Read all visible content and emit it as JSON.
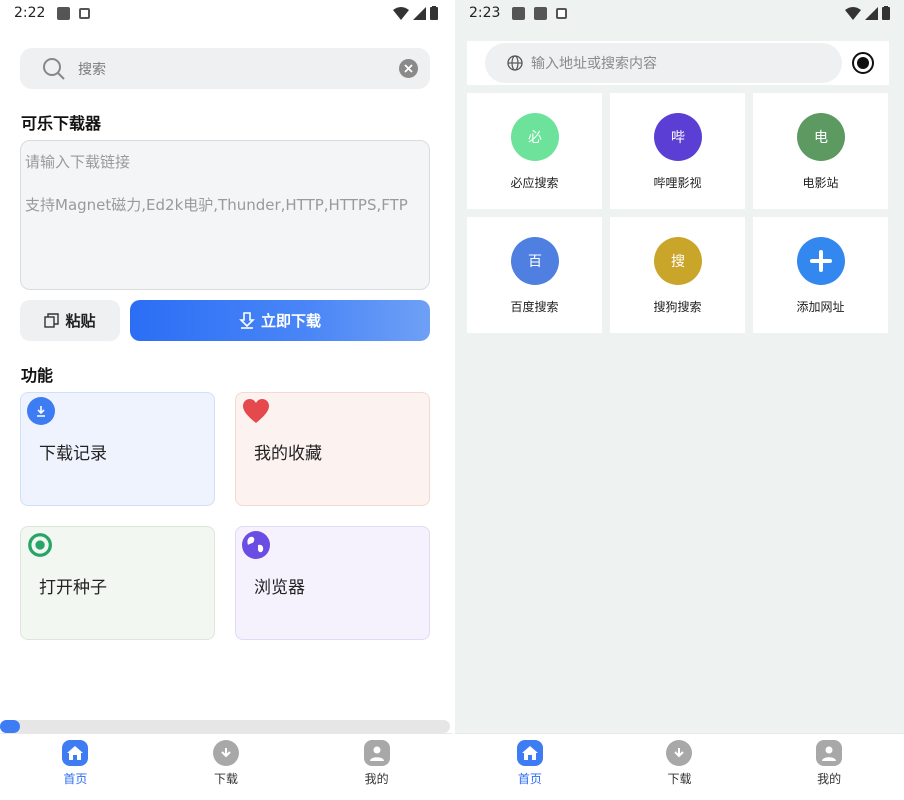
{
  "left": {
    "status": {
      "time": "2:22"
    },
    "search": {
      "label": "搜索"
    },
    "downloader": {
      "title": "可乐下载器",
      "placeholder_line1": "请输入下载链接",
      "placeholder_line2": "支持Magnet磁力,Ed2k电驴,Thunder,HTTP,HTTPS,FTP",
      "paste_label": "粘贴",
      "download_label": "立即下载"
    },
    "features": {
      "title": "功能",
      "items": [
        {
          "label": "下载记录",
          "icon": "download-icon"
        },
        {
          "label": "我的收藏",
          "icon": "heart-icon"
        },
        {
          "label": "打开种子",
          "icon": "eye-icon"
        },
        {
          "label": "浏览器",
          "icon": "globe-icon"
        }
      ]
    },
    "progress": {
      "fraction": 0.045
    }
  },
  "right": {
    "status": {
      "time": "2:23"
    },
    "address": {
      "placeholder": "输入地址或搜索内容"
    },
    "sites": [
      {
        "label": "必应搜索",
        "glyph": "必",
        "color": "#6de29a"
      },
      {
        "label": "哔哩影视",
        "glyph": "哔",
        "color": "#5b3fd4"
      },
      {
        "label": "电影站",
        "glyph": "电",
        "color": "#5d9a62"
      },
      {
        "label": "百度搜索",
        "glyph": "百",
        "color": "#4f7fe0"
      },
      {
        "label": "搜狗搜索",
        "glyph": "搜",
        "color": "#c9a52a"
      },
      {
        "label": "添加网址",
        "glyph": "+",
        "color": "#3388f0"
      }
    ]
  },
  "nav": {
    "items": [
      {
        "label": "首页",
        "icon": "home-icon"
      },
      {
        "label": "下载",
        "icon": "download-nav-icon"
      },
      {
        "label": "我的",
        "icon": "profile-icon"
      }
    ]
  },
  "colors": {
    "accent": "#2b6ef5"
  }
}
